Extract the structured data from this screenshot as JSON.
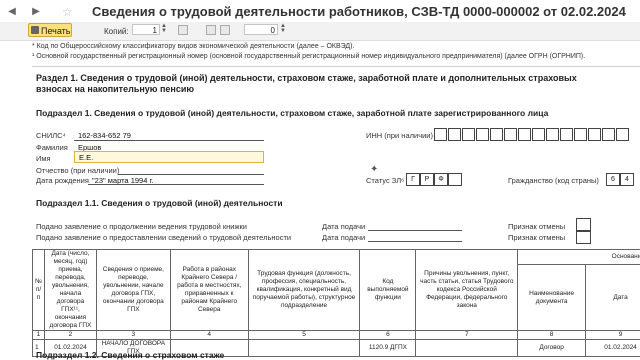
{
  "window": {
    "title": "Сведения о трудовой деятельности работников, СЗВ-ТД 0000-000002 от 02.02.2024"
  },
  "toolbar": {
    "print_label": "Печать",
    "copies_label": "Копий:",
    "copies_value": "1",
    "zoom_value": "0"
  },
  "notes": {
    "okved": "* Код по Общероссийскому классификатору видов экономической деятельности (далее – ОКВЭД).",
    "ogrn": "¹ Основной государственный регистрационный номер (основной государственный регистрационный номер индивидуального предпринимателя) (далее ОГРН (ОГРНИП)."
  },
  "section1": {
    "title_line1": "Раздел 1. Сведения о трудовой (иной) деятельности, страховом стаже, заработной плате и дополнительных страховых",
    "title_line2": "взносах на накопительную пенсию",
    "sub1_title": "Подраздел 1. Сведения о трудовой (иной) деятельности, страховом стаже, заработной плате зарегистрированного лица"
  },
  "person": {
    "snils_label": "СНИЛС⁴",
    "snils_value": "162-834-652 79",
    "surname_label": "Фамилия",
    "surname_value": "Ершов",
    "name_label": "Имя",
    "name_value": "Е.Е.",
    "patronymic_label": "Отчество (при наличии)",
    "patronymic_value": "",
    "birth_label": "Дата рождения",
    "birth_value": "\"23\" марта 1994 г.",
    "inn_label": "ИНН (при наличии)",
    "status_label": "Статус ЗЛ⁶",
    "status_cells": [
      "Г",
      "Р",
      "Ф"
    ],
    "citizenship_label": "Гражданство (код страны)",
    "citizenship_cells": [
      "6",
      "4"
    ]
  },
  "sub11": {
    "title": "Подраздел 1.1. Сведения о трудовой (иной) деятельности",
    "row1_label": "Подано заявление о продолжении ведения трудовой книжки",
    "row2_label": "Подано заявление о предоставлении сведений о трудовой деятельности",
    "date_label": "Дата подачи",
    "cancel_label": "Признак отмены"
  },
  "table": {
    "basis_header": "Основание",
    "headers": [
      "№ п/п",
      "Дата (число, месяц, год) приема, перевода, увольнения, начала договора ГПХ¹¹, окончания договора ГПХ",
      "Сведения о приеме, переводе, увольнении, начале договора ГПХ, окончании договора ГПХ",
      "Работа в районах Крайнего Севера / работа в местностях, приравненных к районам Крайнего Севера",
      "Трудовая функция (должность, профессия, специальность, квалификация, конкретный вид поручаемой работы), структурное подразделение",
      "Код выполняемой функции",
      "Причины увольнения, пункт, часть статьи, статья Трудового кодекса Российской Федерации, федерального закона",
      "Наименование документа",
      "Дата"
    ],
    "numbers": [
      "1",
      "2",
      "3",
      "4",
      "5",
      "6",
      "7",
      "8",
      "9"
    ],
    "rows": [
      [
        "1",
        "01.02.2024",
        "НАЧАЛО ДОГОВОРА ГПХ",
        "",
        "",
        "1120.9 ДГПХ",
        "",
        "Договор",
        "01.02.2024"
      ]
    ]
  },
  "sub12": {
    "title": "Подраздел 1.2. Сведения о страховом стаже"
  }
}
